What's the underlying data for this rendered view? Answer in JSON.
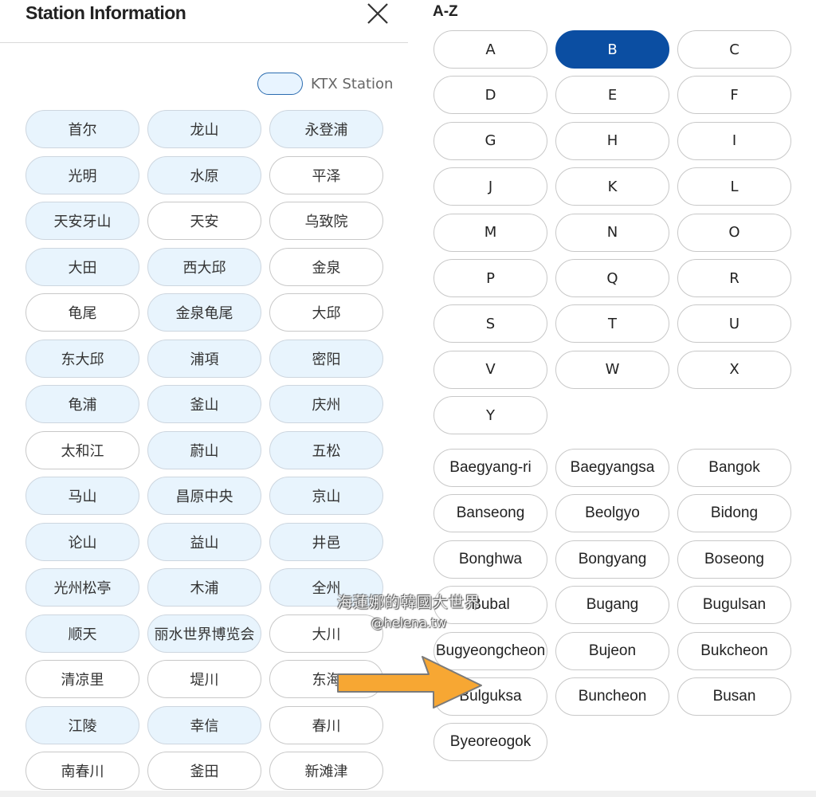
{
  "left": {
    "title": "Station Information",
    "legend_label": "KTX Station",
    "stations": [
      {
        "name": "首尔",
        "ktx": true
      },
      {
        "name": "龙山",
        "ktx": true
      },
      {
        "name": "永登浦",
        "ktx": true
      },
      {
        "name": "光明",
        "ktx": true
      },
      {
        "name": "水原",
        "ktx": true
      },
      {
        "name": "平泽",
        "ktx": false
      },
      {
        "name": "天安牙山",
        "ktx": true
      },
      {
        "name": "天安",
        "ktx": false
      },
      {
        "name": "乌致院",
        "ktx": false
      },
      {
        "name": "大田",
        "ktx": true
      },
      {
        "name": "西大邱",
        "ktx": true
      },
      {
        "name": "金泉",
        "ktx": false
      },
      {
        "name": "龟尾",
        "ktx": false
      },
      {
        "name": "金泉龟尾",
        "ktx": true
      },
      {
        "name": "大邱",
        "ktx": false
      },
      {
        "name": "东大邱",
        "ktx": true
      },
      {
        "name": "浦項",
        "ktx": true
      },
      {
        "name": "密阳",
        "ktx": true
      },
      {
        "name": "龟浦",
        "ktx": true
      },
      {
        "name": "釜山",
        "ktx": true
      },
      {
        "name": "庆州",
        "ktx": true
      },
      {
        "name": "太和江",
        "ktx": false
      },
      {
        "name": "蔚山",
        "ktx": true
      },
      {
        "name": "五松",
        "ktx": true
      },
      {
        "name": "马山",
        "ktx": true
      },
      {
        "name": "昌原中央",
        "ktx": true
      },
      {
        "name": "京山",
        "ktx": true
      },
      {
        "name": "论山",
        "ktx": true
      },
      {
        "name": "益山",
        "ktx": true
      },
      {
        "name": "井邑",
        "ktx": true
      },
      {
        "name": "光州松亭",
        "ktx": true
      },
      {
        "name": "木浦",
        "ktx": true
      },
      {
        "name": "全州",
        "ktx": true
      },
      {
        "name": "顺天",
        "ktx": true
      },
      {
        "name": "丽水世界博览会",
        "ktx": true
      },
      {
        "name": "大川",
        "ktx": false
      },
      {
        "name": "清凉里",
        "ktx": false
      },
      {
        "name": "堤川",
        "ktx": false
      },
      {
        "name": "东海",
        "ktx": false
      },
      {
        "name": "江陵",
        "ktx": true
      },
      {
        "name": "幸信",
        "ktx": true
      },
      {
        "name": "春川",
        "ktx": false
      },
      {
        "name": "南春川",
        "ktx": false
      },
      {
        "name": "釜田",
        "ktx": false
      },
      {
        "name": "新滩津",
        "ktx": false
      }
    ]
  },
  "right": {
    "section_title": "A-Z",
    "letters": [
      "A",
      "B",
      "C",
      "D",
      "E",
      "F",
      "G",
      "H",
      "I",
      "J",
      "K",
      "L",
      "M",
      "N",
      "O",
      "P",
      "Q",
      "R",
      "S",
      "T",
      "U",
      "V",
      "W",
      "X",
      "Y"
    ],
    "selected_letter": "B",
    "stations": [
      "Baegyang-ri",
      "Baegyangsa",
      "Bangok",
      "Banseong",
      "Beolgyo",
      "Bidong",
      "Bonghwa",
      "Bongyang",
      "Boseong",
      "Bubal",
      "Bugang",
      "Bugulsan",
      "Bugyeongcheon",
      "Bujeon",
      "Bukcheon",
      "Bulguksa",
      "Buncheon",
      "Busan",
      "Byeoreogok"
    ]
  },
  "watermark": {
    "line1": "海蓮娜的韓國大世界",
    "line2": "@helena.tw"
  },
  "colors": {
    "ktx_fill": "#e8f4fd",
    "ktx_outline": "#2b6cb0",
    "selected_letter": "#0b4ea2",
    "arrow": "#f7a733"
  },
  "icons": {
    "close": "close-icon",
    "arrow": "arrow-right-icon"
  }
}
